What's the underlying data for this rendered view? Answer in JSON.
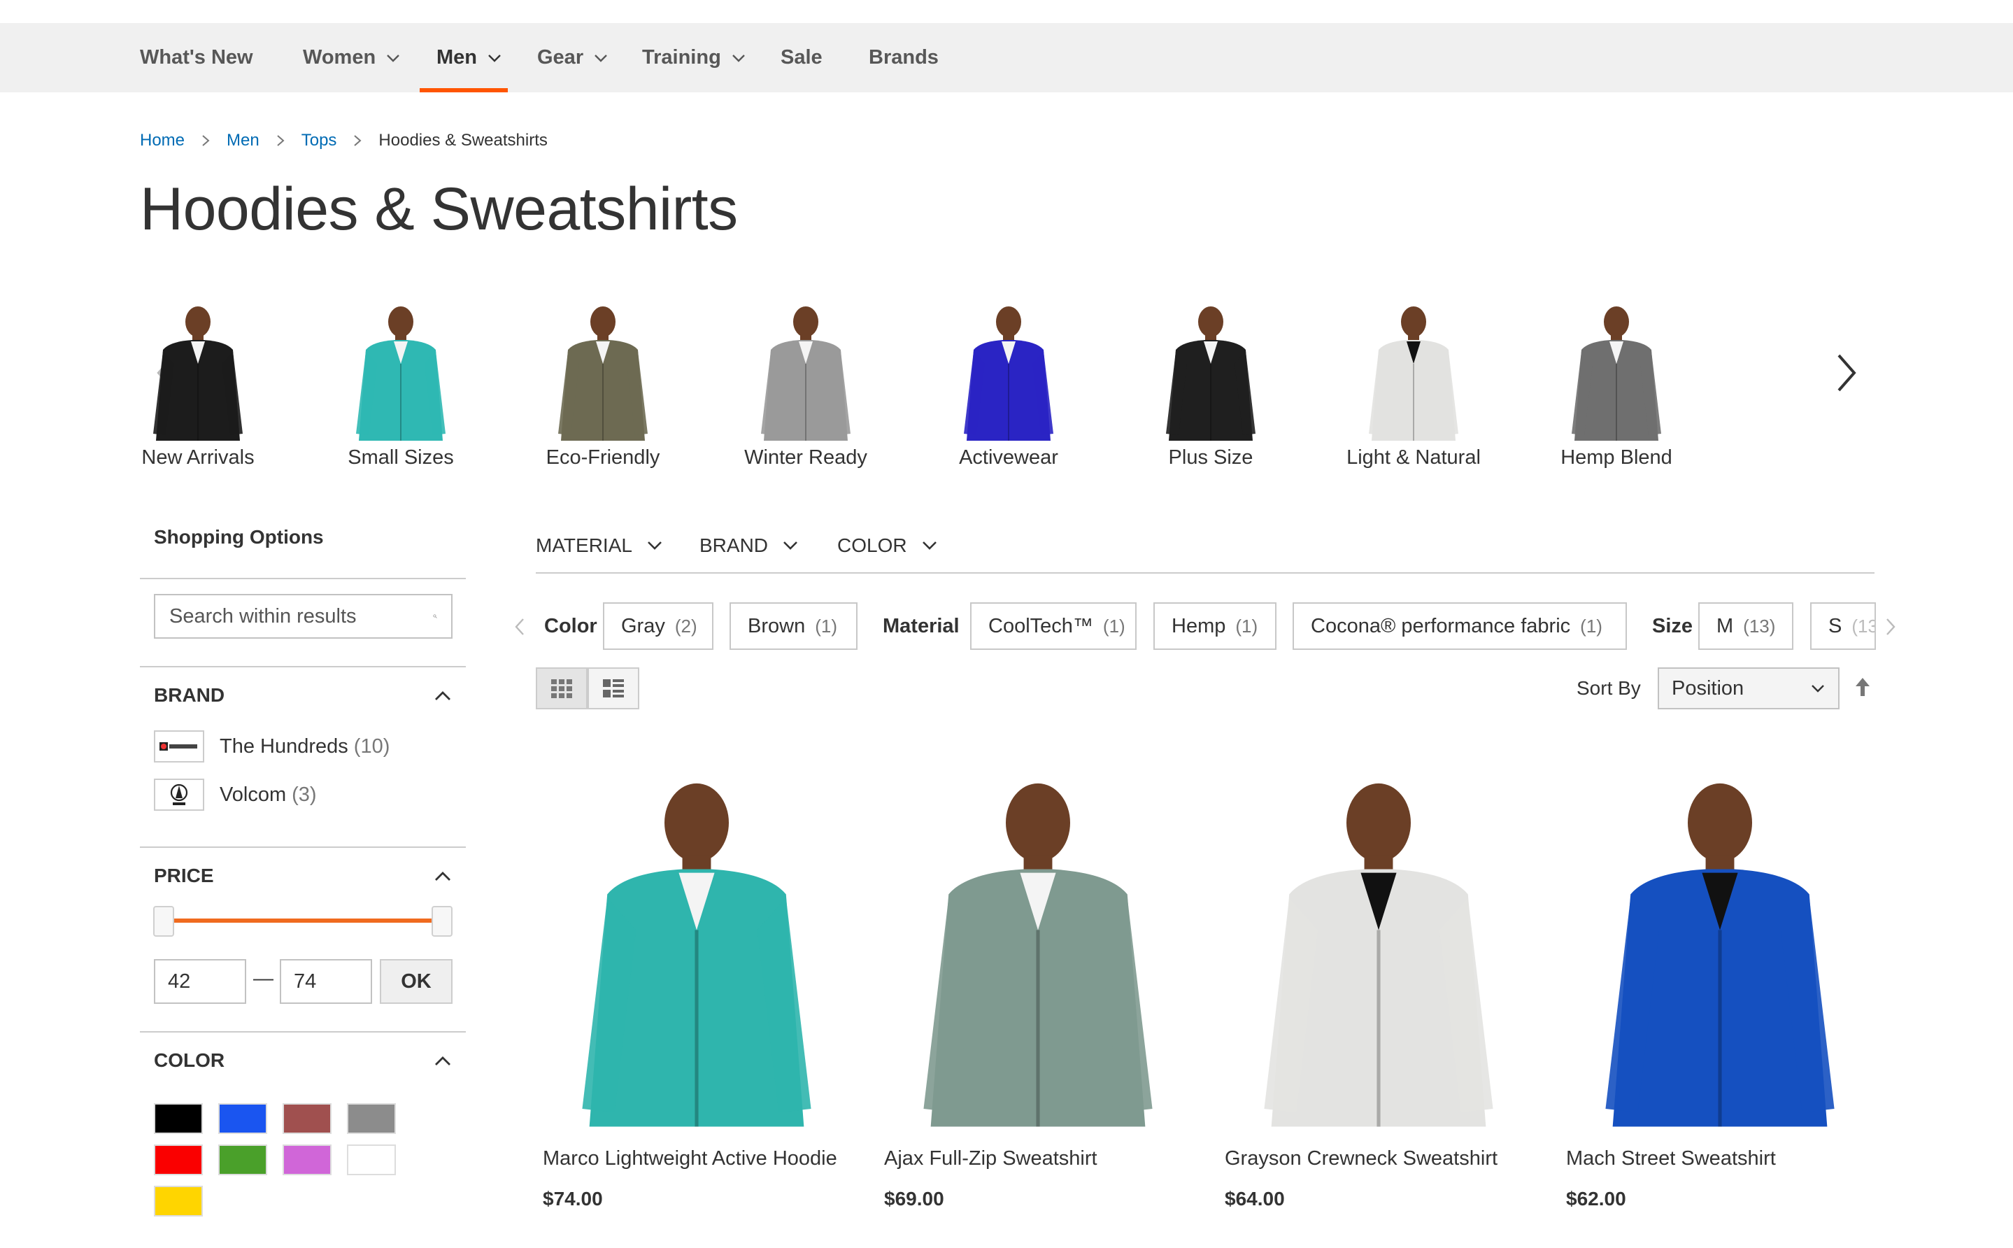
{
  "nav": {
    "items": [
      {
        "label": "What's New",
        "has_menu": false
      },
      {
        "label": "Women",
        "has_menu": true
      },
      {
        "label": "Men",
        "has_menu": true,
        "active": true
      },
      {
        "label": "Gear",
        "has_menu": true
      },
      {
        "label": "Training",
        "has_menu": true
      },
      {
        "label": "Sale",
        "has_menu": false
      },
      {
        "label": "Brands",
        "has_menu": false
      }
    ]
  },
  "breadcrumb": {
    "items": [
      "Home",
      "Men",
      "Tops"
    ],
    "current": "Hoodies & Sweatshirts"
  },
  "page_title": "Hoodies & Sweatshirts",
  "categories": [
    {
      "label": "New Arrivals",
      "color": "#1c1c1c"
    },
    {
      "label": "Small Sizes",
      "color": "#2fb8b3"
    },
    {
      "label": "Eco-Friendly",
      "color": "#6d6a52"
    },
    {
      "label": "Winter Ready",
      "color": "#9a9a9a"
    },
    {
      "label": "Activewear",
      "color": "#2a24c4"
    },
    {
      "label": "Plus Size",
      "color": "#1f1f1f"
    },
    {
      "label": "Light & Natural",
      "color": "#e2e2e0"
    },
    {
      "label": "Hemp Blend",
      "color": "#6f6f6f"
    }
  ],
  "sidebar": {
    "title": "Shopping Options",
    "search_placeholder": "Search within results",
    "brand": {
      "title": "BRAND",
      "items": [
        {
          "label": "The Hundreds",
          "count": "(10)"
        },
        {
          "label": "Volcom",
          "count": "(3)"
        }
      ]
    },
    "price": {
      "title": "PRICE",
      "min": "42",
      "max": "74",
      "dash": "—",
      "ok": "OK"
    },
    "color": {
      "title": "COLOR",
      "swatches": [
        "#000000",
        "#1a55f0",
        "#a0504f",
        "#8c8c8c",
        "#fa0000",
        "#4aa02a",
        "#d066d8",
        "#ffffff",
        "#ffd500"
      ]
    }
  },
  "filter_tabs": [
    "MATERIAL",
    "BRAND",
    "COLOR"
  ],
  "active_filters": {
    "color_label": "Color",
    "color_chips": [
      {
        "label": "Gray",
        "count": "(2)"
      },
      {
        "label": "Brown",
        "count": "(1)"
      }
    ],
    "material_label": "Material",
    "material_chips": [
      {
        "label": "CoolTech™",
        "count": "(1)"
      },
      {
        "label": "Hemp",
        "count": "(1)"
      },
      {
        "label": "Cocona® performance fabric",
        "count": "(1)"
      }
    ],
    "size_label": "Size",
    "size_chips": [
      {
        "label": "M",
        "count": "(13)"
      },
      {
        "label": "S",
        "count": "(13"
      }
    ]
  },
  "toolbar": {
    "sort_label": "Sort By",
    "sort_value": "Position"
  },
  "products": [
    {
      "name": "Marco Lightweight Active Hoodie",
      "price": "$74.00",
      "color": "#2fb5ad"
    },
    {
      "name": "Ajax Full-Zip Sweatshirt",
      "price": "$69.00",
      "color": "#7f9a90"
    },
    {
      "name": "Grayson Crewneck Sweatshirt",
      "price": "$64.00",
      "color": "#e3e3e1"
    },
    {
      "name": "Mach Street Sweatshirt",
      "price": "$62.00",
      "color": "#1550c0"
    }
  ],
  "colors": {
    "accent": "#ff5501",
    "link": "#006bb4",
    "nav_bg": "#f0f0f0"
  }
}
